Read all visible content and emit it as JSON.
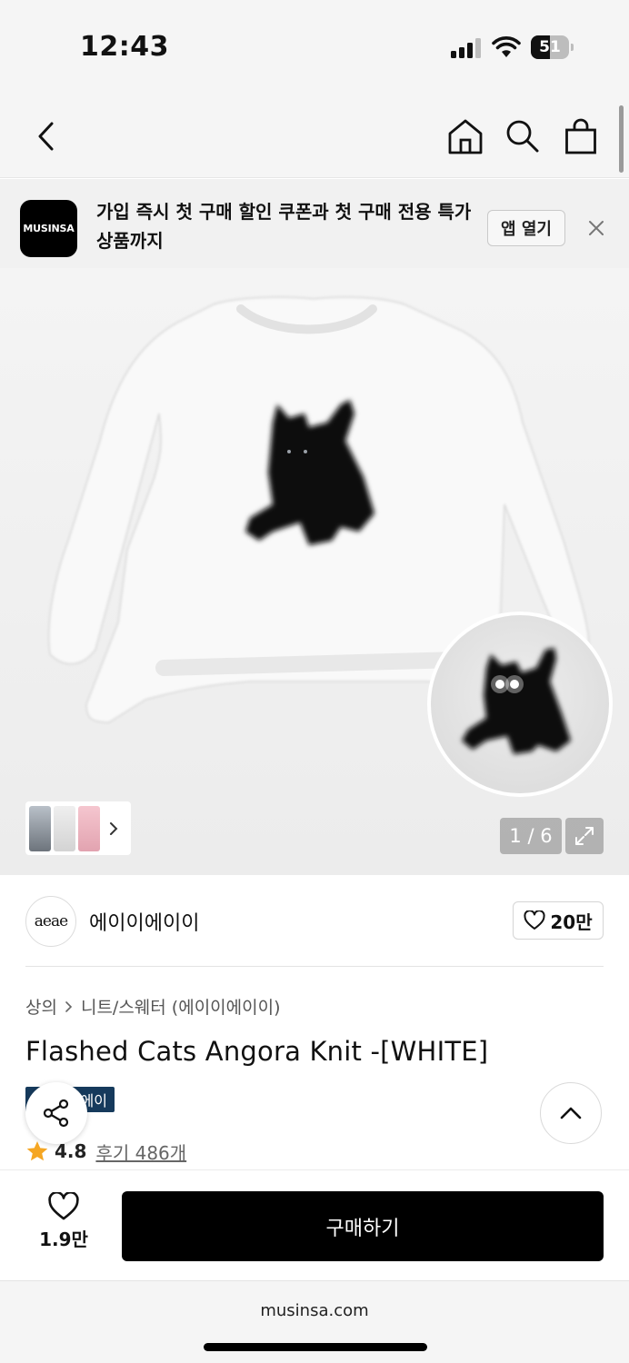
{
  "status_bar": {
    "time": "12:43",
    "battery": "51",
    "battery_level": 0.51
  },
  "nav": {
    "back_icon": "chevron-left-icon",
    "home_icon": "home-icon",
    "search_icon": "search-icon",
    "cart_icon": "shopping-bag-icon"
  },
  "banner": {
    "logo_text": "MUSINSA",
    "message": "가입 즉시 첫 구매 할인 쿠폰과 첫 구매 전용 특가 상품까지",
    "open_label": "앱 열기",
    "close_icon": "close-icon"
  },
  "gallery": {
    "page_indicator": "1 / 6",
    "expand_icon": "expand-icon",
    "thumb_icon": "chevron-right-icon"
  },
  "brand": {
    "logo_text": "aeae",
    "name": "에이이에이이",
    "likes": "20만"
  },
  "product": {
    "breadcrumb": [
      "상의",
      "니트/스웨터 (에이이에이이)"
    ],
    "title": "Flashed Cats Angora Knit -[WHITE]",
    "badge": "에이",
    "rating": "4.8",
    "review_text": "후기 486개"
  },
  "bottom_bar": {
    "wish_count": "1.9만",
    "buy_label": "구매하기"
  },
  "browser": {
    "url": "musinsa.com"
  },
  "colors": {
    "accent": "#000000",
    "star": "#f5a623",
    "badge": "#163a5c"
  }
}
